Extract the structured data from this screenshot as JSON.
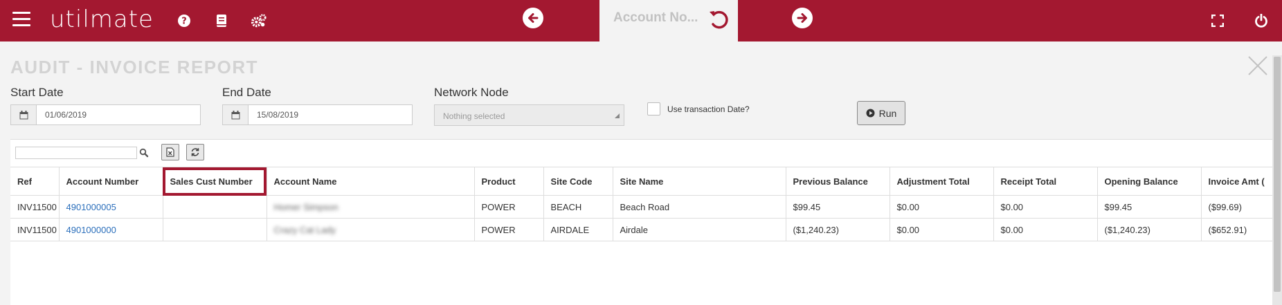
{
  "topbar": {
    "logo_text": "utilmate",
    "icons": [
      "menu-icon",
      "help-icon",
      "book-icon",
      "settings-icon",
      "arrow-left-icon",
      "undo-icon",
      "arrow-right-icon",
      "fullscreen-icon",
      "power-icon"
    ],
    "account_tab_label": "Account No...",
    "colors": {
      "bar": "#a31830",
      "tab_bg": "#f3f3f3"
    }
  },
  "report": {
    "title": "AUDIT - INVOICE REPORT",
    "start_date_label": "Start Date",
    "start_date_value": "01/06/2019",
    "end_date_label": "End Date",
    "end_date_value": "15/08/2019",
    "network_node_label": "Network Node",
    "network_node_value": "Nothing selected",
    "use_transaction_date_label": "Use transaction Date?",
    "use_transaction_date_checked": false,
    "run_label": "Run"
  },
  "table": {
    "search_value": "",
    "columns": [
      "Ref",
      "Account Number",
      "Sales Cust Number",
      "Account Name",
      "Product",
      "Site Code",
      "Site Name",
      "Previous Balance",
      "Adjustment Total",
      "Receipt Total",
      "Opening Balance",
      "Invoice Amt ("
    ],
    "highlighted_column": "Sales Cust Number",
    "rows": [
      [
        "INV11500",
        "4901000005",
        "",
        "Homer Simpson",
        "POWER",
        "BEACH",
        "Beach Road",
        "$99.45",
        "$0.00",
        "$0.00",
        "$99.45",
        "($99.69)"
      ],
      [
        "INV11500",
        "4901000000",
        "",
        "Crazy Cat Lady",
        "POWER",
        "AIRDALE",
        "Airdale",
        "($1,240.23)",
        "$0.00",
        "$0.00",
        "($1,240.23)",
        "($652.91)"
      ]
    ]
  }
}
